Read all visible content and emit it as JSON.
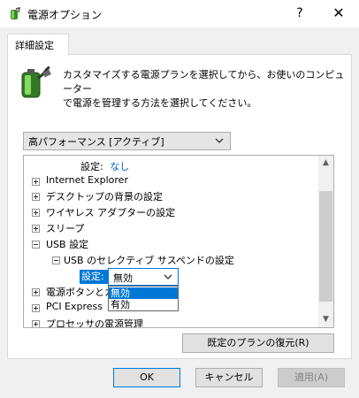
{
  "window": {
    "title": "電源オプション",
    "help_glyph": "?",
    "close_glyph": "✕"
  },
  "tab": {
    "label": "詳細設定"
  },
  "description": {
    "line1": "カスタマイズする電源プランを選択してから、お使いのコンピューター",
    "line2": "で電源を管理する方法を選択してください。"
  },
  "plan_select": {
    "value": "高パフォーマンス [アクティブ]"
  },
  "tree": {
    "top_setting_label": "設定:",
    "top_setting_value": "なし",
    "items": [
      {
        "label": "Internet Explorer"
      },
      {
        "label": "デスクトップの背景の設定"
      },
      {
        "label": "ワイヤレス アダプターの設定"
      },
      {
        "label": "スリープ"
      },
      {
        "label": "USB 設定"
      },
      {
        "label": "USB のセレクティブ サスペンドの設定"
      },
      {
        "label": "電源ボタンとカ"
      },
      {
        "label": "PCI Express"
      },
      {
        "label": "プロセッサの電源管理"
      }
    ],
    "setting_label": "設定:",
    "setting_value": "無効"
  },
  "dropdown": {
    "options": [
      "無効",
      "有効"
    ],
    "selected": "無効"
  },
  "buttons": {
    "restore": "既定のプランの復元(R)",
    "ok": "OK",
    "cancel": "キャンセル",
    "apply": "適用(A)"
  },
  "colors": {
    "accent": "#0078d7",
    "link": "#0066cc",
    "window_bg": "#f0f0f0"
  }
}
